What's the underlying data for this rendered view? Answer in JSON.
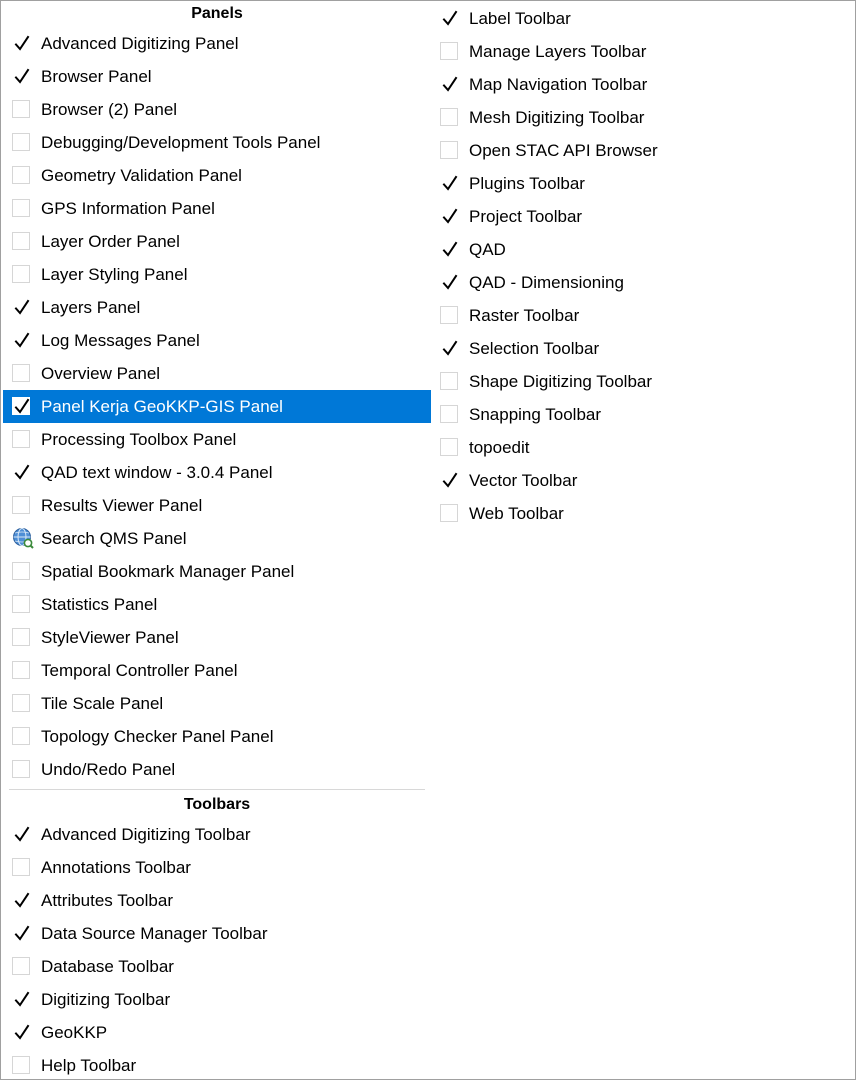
{
  "panels": {
    "header": "Panels",
    "items": [
      {
        "label": "Advanced Digitizing Panel",
        "checked": true
      },
      {
        "label": "Browser Panel",
        "checked": true
      },
      {
        "label": "Browser (2) Panel",
        "checked": false
      },
      {
        "label": "Debugging/Development Tools Panel",
        "checked": false
      },
      {
        "label": "Geometry Validation Panel",
        "checked": false
      },
      {
        "label": "GPS Information Panel",
        "checked": false
      },
      {
        "label": "Layer Order Panel",
        "checked": false
      },
      {
        "label": "Layer Styling Panel",
        "checked": false
      },
      {
        "label": "Layers Panel",
        "checked": true
      },
      {
        "label": "Log Messages Panel",
        "checked": true
      },
      {
        "label": "Overview Panel",
        "checked": false
      },
      {
        "label": "Panel Kerja GeoKKP-GIS Panel",
        "checked": true,
        "highlighted": true
      },
      {
        "label": "Processing Toolbox Panel",
        "checked": false
      },
      {
        "label": "QAD text window - 3.0.4 Panel",
        "checked": true
      },
      {
        "label": "Results Viewer Panel",
        "checked": false
      },
      {
        "label": "Search QMS Panel",
        "checked": false,
        "icon": "globe-search-icon"
      },
      {
        "label": "Spatial Bookmark Manager Panel",
        "checked": false
      },
      {
        "label": "Statistics Panel",
        "checked": false
      },
      {
        "label": "StyleViewer Panel",
        "checked": false
      },
      {
        "label": "Temporal Controller Panel",
        "checked": false
      },
      {
        "label": "Tile Scale Panel",
        "checked": false
      },
      {
        "label": "Topology Checker Panel Panel",
        "checked": false
      },
      {
        "label": "Undo/Redo Panel",
        "checked": false
      }
    ]
  },
  "toolbars": {
    "header": "Toolbars",
    "items_left": [
      {
        "label": "Advanced Digitizing Toolbar",
        "checked": true
      },
      {
        "label": "Annotations Toolbar",
        "checked": false
      },
      {
        "label": "Attributes Toolbar",
        "checked": true
      },
      {
        "label": "Data Source Manager Toolbar",
        "checked": true
      },
      {
        "label": "Database Toolbar",
        "checked": false
      },
      {
        "label": "Digitizing Toolbar",
        "checked": true
      },
      {
        "label": "GeoKKP",
        "checked": true
      },
      {
        "label": "Help Toolbar",
        "checked": false
      }
    ],
    "items_right": [
      {
        "label": "Label Toolbar",
        "checked": true
      },
      {
        "label": "Manage Layers Toolbar",
        "checked": false
      },
      {
        "label": "Map Navigation Toolbar",
        "checked": true
      },
      {
        "label": "Mesh Digitizing Toolbar",
        "checked": false
      },
      {
        "label": "Open STAC API Browser",
        "checked": false
      },
      {
        "label": "Plugins Toolbar",
        "checked": true
      },
      {
        "label": "Project Toolbar",
        "checked": true
      },
      {
        "label": "QAD",
        "checked": true
      },
      {
        "label": "QAD - Dimensioning",
        "checked": true
      },
      {
        "label": "Raster Toolbar",
        "checked": false
      },
      {
        "label": "Selection Toolbar",
        "checked": true
      },
      {
        "label": "Shape Digitizing Toolbar",
        "checked": false
      },
      {
        "label": "Snapping Toolbar",
        "checked": false
      },
      {
        "label": "topoedit",
        "checked": false
      },
      {
        "label": "Vector Toolbar",
        "checked": true
      },
      {
        "label": "Web Toolbar",
        "checked": false
      }
    ]
  },
  "colors": {
    "highlight": "#0078d7",
    "border": "#a0a0a0"
  }
}
